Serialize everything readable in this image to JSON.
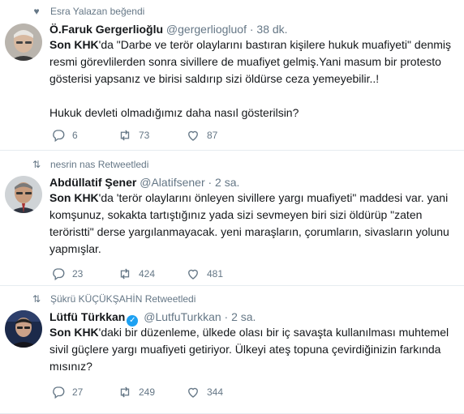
{
  "tweets": [
    {
      "context": "Esra Yalazan beğendi",
      "context_icon": "heart-icon",
      "name": "Ö.Faruk Gergerlioğlu",
      "handle": "@gergerliogluof",
      "time": "· 38 dk.",
      "hl": "Son KHK",
      "text_after_hl": "'da \"Darbe ve terör olaylarını bastıran kişilere hukuk muafiyeti\" denmiş resmi görevlilerden sonra sivillere de muafiyet gelmiş.Yani masum bir protesto gösterisi yapsanız ve birisi saldırıp sizi öldürse ceza yemeyebilir..!",
      "text_p2": "Hukuk devleti olmadığımız daha nasıl gösterilsin?",
      "replies": "6",
      "retweets": "73",
      "likes": "87"
    },
    {
      "context": "nesrin nas Retweetledi",
      "context_icon": "retweet-icon",
      "name": "Abdüllatif Şener",
      "handle": "@Alatifsener",
      "time": "· 2 sa.",
      "hl": "Son KHK",
      "text_after_hl": "'da 'terör olaylarını önleyen sivillere yargı muafiyeti\" maddesi var. yani komşunuz, sokakta tartıştığınız yada sizi sevmeyen biri sizi öldürüp \"zaten teröristti\" derse yargılanmayacak. yeni maraşların, çorumların, sivasların yolunu yapmışlar.",
      "replies": "23",
      "retweets": "424",
      "likes": "481"
    },
    {
      "context": "Şükrü KÜÇÜKŞAHİN Retweetledi",
      "context_icon": "retweet-icon",
      "name": "Lütfü Türkkan",
      "handle": "@LutfuTurkkan",
      "time": "· 2 sa.",
      "hl": "Son KHK",
      "text_after_hl": "'daki bir düzenleme, ülkede olası bir iç savaşta kullanılması muhtemel sivil güçlere yargı muafiyeti getiriyor. Ülkeyi ateş topuna çevirdiğinizin farkında mısınız?",
      "replies": "27",
      "retweets": "249",
      "likes": "344"
    }
  ],
  "colors": {
    "text": "#14171a",
    "muted": "#657786",
    "border": "#e6ecf0",
    "verified": "#1da1f2"
  }
}
